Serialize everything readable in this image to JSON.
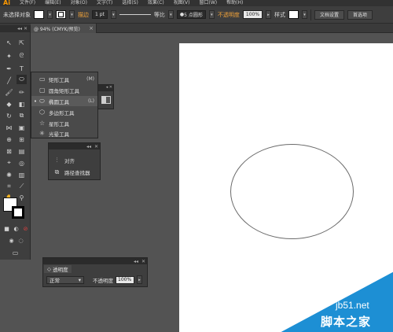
{
  "app": {
    "logo": "Ai",
    "menu": [
      "文件(F)",
      "编辑(E)",
      "对象(O)",
      "文字(T)",
      "选择(S)",
      "效果(C)",
      "视图(V)",
      "窗口(W)",
      "帮助(H)"
    ]
  },
  "control_bar": {
    "selection_label": "未选择对象",
    "stroke_label": "描边",
    "stroke_weight": "1 pt",
    "stroke_profile": "等比",
    "brush": "5 点圆形",
    "opacity_label": "不透明度",
    "opacity_value": "100%",
    "style_label": "样式",
    "doc_setup": "文档设置",
    "prefs": "首选项"
  },
  "document": {
    "tab_title": "@ 94% (CMYK/预览)"
  },
  "shape_flyout": {
    "items": [
      {
        "label": "矩形工具",
        "shortcut": "(M)",
        "icon": "rectangle-icon"
      },
      {
        "label": "圆角矩形工具",
        "shortcut": "",
        "icon": "rounded-rectangle-icon"
      },
      {
        "label": "椭圆工具",
        "shortcut": "(L)",
        "icon": "ellipse-icon"
      },
      {
        "label": "多边形工具",
        "shortcut": "",
        "icon": "polygon-icon"
      },
      {
        "label": "星形工具",
        "shortcut": "",
        "icon": "star-icon"
      },
      {
        "label": "光晕工具",
        "shortcut": "",
        "icon": "flare-icon"
      }
    ]
  },
  "align_panel": {
    "items": [
      "对齐",
      "路径查找器"
    ]
  },
  "transparency_panel": {
    "title": "透明度",
    "blend_mode": "正常",
    "opacity_label": "不透明度",
    "opacity_value": "100%"
  },
  "watermark": {
    "site": "jb51.net",
    "name": "脚本之家"
  },
  "colors": {
    "accent_orange": "#ff9a00",
    "watermark_blue": "#1d8fd4",
    "ui_dark": "#3e3e3e",
    "workspace": "#535353"
  }
}
